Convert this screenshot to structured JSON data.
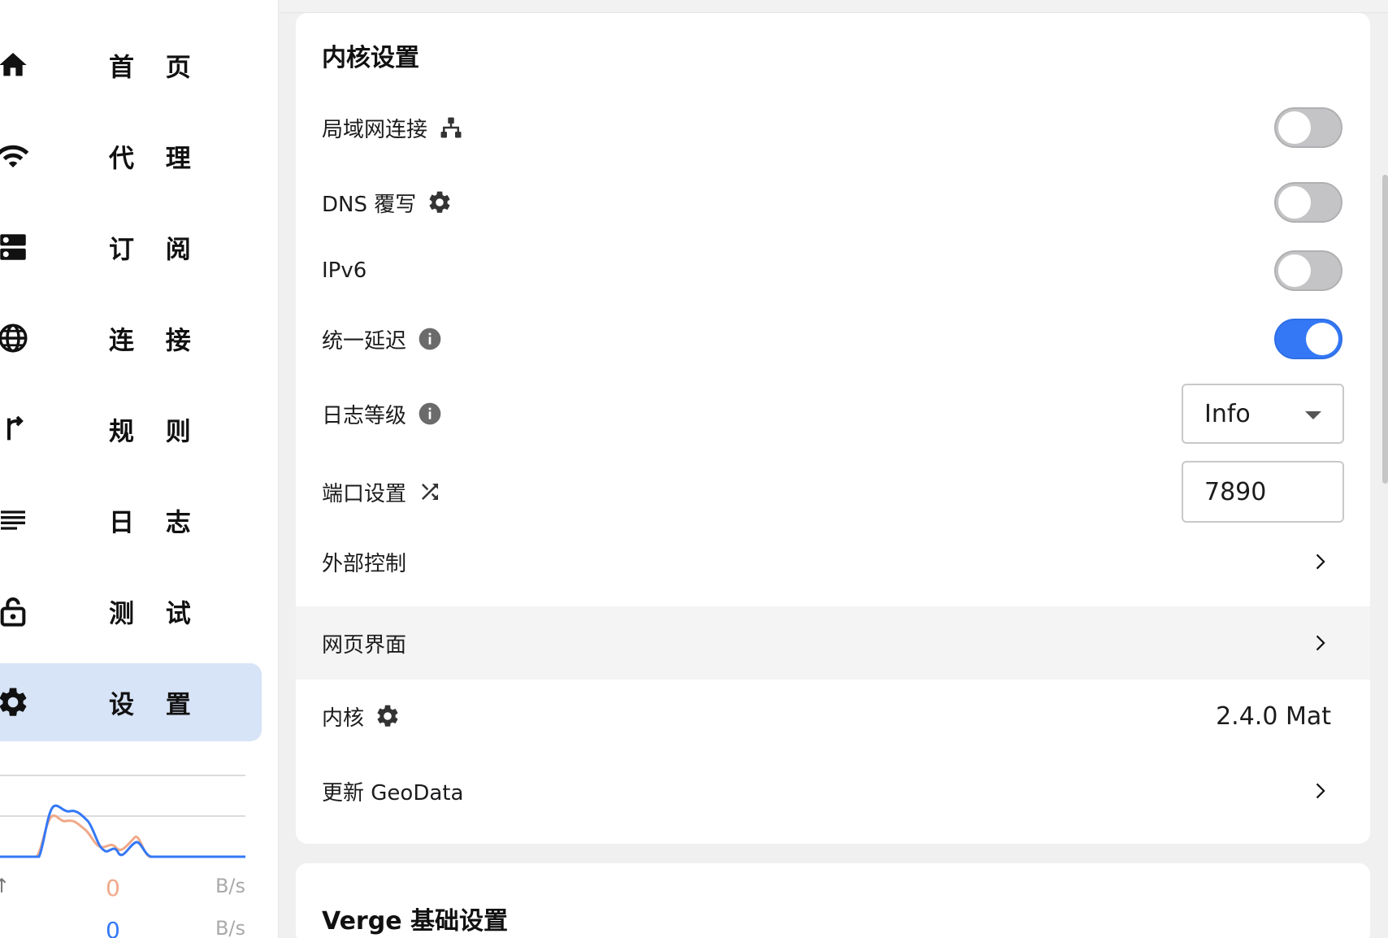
{
  "sidebar": {
    "items": [
      {
        "label": "首 页",
        "icon": "home-icon"
      },
      {
        "label": "代 理",
        "icon": "wifi-icon"
      },
      {
        "label": "订 阅",
        "icon": "server-icon"
      },
      {
        "label": "连 接",
        "icon": "globe-icon"
      },
      {
        "label": "规 则",
        "icon": "fork-icon"
      },
      {
        "label": "日 志",
        "icon": "list-icon"
      },
      {
        "label": "测 试",
        "icon": "lock-icon"
      },
      {
        "label": "设 置",
        "icon": "gear-icon"
      }
    ],
    "active_index": 7,
    "traffic": {
      "up_value": "0",
      "up_unit": "B/s",
      "down_value": "0",
      "down_unit": "B/s",
      "up_arrow": "↑",
      "colors": {
        "upload": "#f0a98a",
        "download": "#3478f6"
      }
    }
  },
  "core_settings": {
    "title": "内核设置",
    "lan": {
      "label": "局域网连接",
      "enabled": false
    },
    "dns": {
      "label": "DNS 覆写",
      "enabled": false
    },
    "ipv6": {
      "label": "IPv6",
      "enabled": false
    },
    "unified_delay": {
      "label": "统一延迟",
      "enabled": true
    },
    "log_level": {
      "label": "日志等级",
      "value": "Info"
    },
    "port": {
      "label": "端口设置",
      "value": "7890"
    },
    "external_control": {
      "label": "外部控制"
    },
    "web_ui": {
      "label": "网页界面"
    },
    "core": {
      "label": "内核",
      "value": "2.4.0 Mat"
    },
    "geodata": {
      "label": "更新 GeoData"
    }
  },
  "verge_settings": {
    "title": "Verge 基础设置"
  },
  "colors": {
    "accent": "#3478f6",
    "active_nav": "#d7e3f6"
  }
}
